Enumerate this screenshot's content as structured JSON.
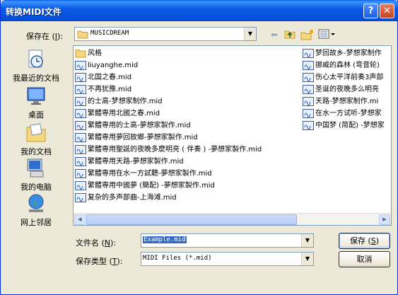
{
  "window": {
    "title": "转换MIDI文件"
  },
  "titlebar": {
    "help_icon": "help-icon",
    "close_icon": "close-icon"
  },
  "lookin": {
    "label_prefix": "保存在 (",
    "label_key": "I",
    "label_suffix": "):",
    "value": "MUSICDREAM"
  },
  "toolbar": {
    "icons": [
      "back-icon",
      "up-folder-icon",
      "new-folder-icon",
      "view-menu-icon"
    ]
  },
  "places": [
    {
      "label": "我最近的文档",
      "icon": "recent-documents-icon"
    },
    {
      "label": "桌面",
      "icon": "desktop-icon"
    },
    {
      "label": "我的文档",
      "icon": "my-documents-icon"
    },
    {
      "label": "我的电脑",
      "icon": "my-computer-icon"
    },
    {
      "label": "网上邻居",
      "icon": "network-places-icon"
    }
  ],
  "files": {
    "col1": [
      {
        "name": "风格",
        "type": "folder"
      },
      {
        "name": "liuyanghe.mid",
        "type": "midi"
      },
      {
        "name": "北国之春.mid",
        "type": "midi"
      },
      {
        "name": "不再犹豫.mid",
        "type": "midi"
      },
      {
        "name": "的士高-梦想家制作.mid",
        "type": "midi"
      },
      {
        "name": "繁體専用北國之春.mid",
        "type": "midi"
      },
      {
        "name": "繁體専用的士高-夢想家製作.mid",
        "type": "midi"
      },
      {
        "name": "繁體専用夢回故鄉-夢想家製作.mid",
        "type": "midi"
      },
      {
        "name": "繁體専用聖誕的夜晚多麼明亮 ( 伴奏 ) -夢想家製作.mid",
        "type": "midi"
      },
      {
        "name": "繁體専用天路-夢想家製作.mid",
        "type": "midi"
      },
      {
        "name": "繁體専用在水一方試聽-夢想家製作.mid",
        "type": "midi"
      },
      {
        "name": "繁體専用中國夢 (簡配) -夢想家製作.mid",
        "type": "midi"
      },
      {
        "name": "复杂的多声部曲-上海滩.mid",
        "type": "midi"
      }
    ],
    "col2": [
      {
        "name": "梦回故乡-梦想家制作",
        "type": "midi"
      },
      {
        "name": "挪威的森林 (弯音轮)",
        "type": "midi"
      },
      {
        "name": "伤心太平洋前奏3声部",
        "type": "midi"
      },
      {
        "name": "圣诞的夜晚多么明亮",
        "type": "midi"
      },
      {
        "name": "天路-梦想家制作.mi",
        "type": "midi"
      },
      {
        "name": "在水一方试听-梦想家",
        "type": "midi"
      },
      {
        "name": "中国梦 (简配) -梦想家",
        "type": "midi"
      }
    ]
  },
  "filename": {
    "label_prefix": "文件名 (",
    "label_key": "N",
    "label_suffix": "):",
    "value": "Example.mid"
  },
  "filetype": {
    "label_prefix": "保存类型 (",
    "label_key": "T",
    "label_suffix": "):",
    "value": "MIDI Files (*.mid)"
  },
  "buttons": {
    "save_prefix": "保存 (",
    "save_key": "S",
    "save_suffix": ")",
    "cancel": "取消"
  },
  "colors": {
    "titlebar": "#0a5fe8",
    "selection": "#316ac5",
    "face": "#ece9d8",
    "border": "#7f9db9"
  }
}
